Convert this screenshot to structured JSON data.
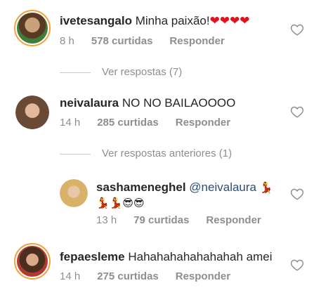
{
  "comments": [
    {
      "username": "ivetesangalo",
      "text": "Minha paixão!",
      "emoji": "❤❤❤❤",
      "time": "8 h",
      "likes": "578 curtidas",
      "reply": "Responder",
      "view_replies": "Ver respostas (7)"
    },
    {
      "username": "neivalaura",
      "text": "NO NO BAILAOOOO",
      "time": "14 h",
      "likes": "285 curtidas",
      "reply": "Responder",
      "view_replies": "Ver respostas anteriores (1)"
    },
    {
      "username": "sashameneghel",
      "mention": "@neivalaura",
      "emoji_line1": "💃",
      "emoji_line2": "💃💃😎😎",
      "time": "13 h",
      "likes": "79 curtidas",
      "reply": "Responder"
    },
    {
      "username": "fepaesleme",
      "text": "Hahahahahahahahah amei",
      "time": "14 h",
      "likes": "275 curtidas",
      "reply": "Responder"
    }
  ],
  "colors": {
    "meta": "#8e8e8e",
    "mention": "#2b4d7a",
    "story_ring": "#f2a23a",
    "heart": "#e0121e"
  },
  "icons": {
    "like": "heart-outline-icon"
  }
}
